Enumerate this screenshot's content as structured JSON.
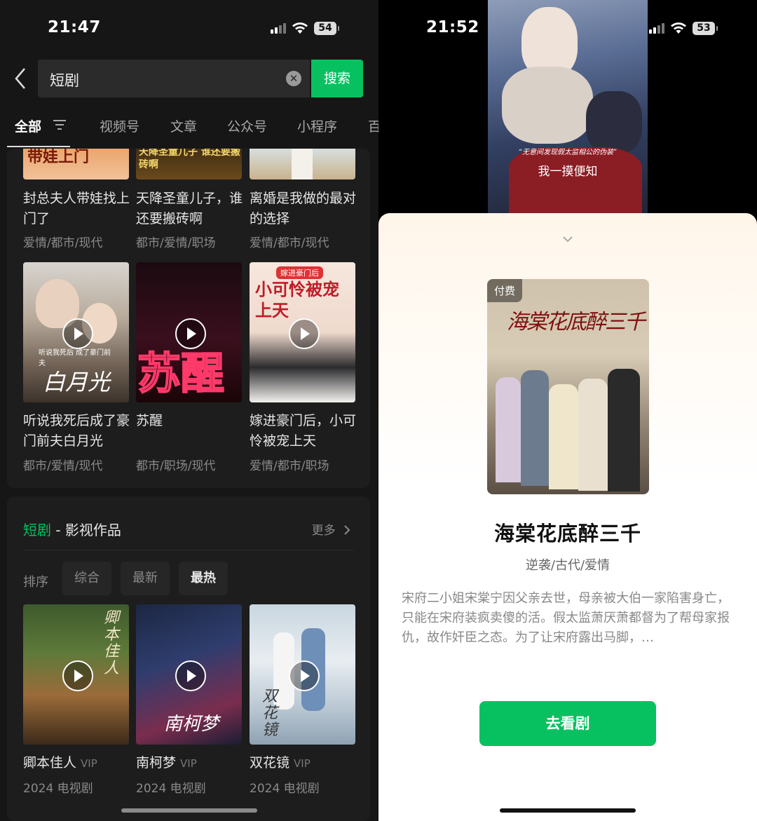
{
  "left": {
    "status": {
      "time": "21:47",
      "battery": "54"
    },
    "search": {
      "query": "短剧",
      "button": "搜索"
    },
    "tabs": [
      "全部",
      "视频号",
      "文章",
      "公众号",
      "小程序",
      "百"
    ],
    "top_items": [
      {
        "title": "封总夫人带娃找上门了",
        "meta": "爱情/都市/现代",
        "poster_text": "带娃上门"
      },
      {
        "title": "天降圣童儿子，谁还要搬砖啊",
        "meta": "都市/爱情/职场",
        "poster_text": "天降圣童儿子 谁还要搬砖啊"
      },
      {
        "title": "离婚是我做的最对的选择",
        "meta": "爱情/都市/现代"
      }
    ],
    "mid_items": [
      {
        "title": "听说我死后成了豪门前夫白月光",
        "meta": "都市/爱情/现代",
        "poster_text": "白月光",
        "poster_small": "听说我死后 成了豪门前夫"
      },
      {
        "title": "苏醒",
        "meta": "都市/职场/现代",
        "poster_text": "苏醒"
      },
      {
        "title": "嫁进豪门后，小可怜被宠上天",
        "meta": "爱情/都市/职场",
        "poster_text": "小可怜被宠上天",
        "poster_small": "嫁进豪门后"
      }
    ],
    "section": {
      "keyword": "短剧",
      "rest": " - 影视作品",
      "more": "更多",
      "sort_label": "排序",
      "chips": [
        "综合",
        "最新",
        "最热"
      ]
    },
    "works": [
      {
        "title": "卿本佳人",
        "badge": "VIP",
        "meta": "2024 电视剧",
        "poster_text": "卿本佳人"
      },
      {
        "title": "南柯梦",
        "badge": "VIP",
        "meta": "2024 电视剧",
        "poster_text": "南柯梦"
      },
      {
        "title": "双花镜",
        "badge": "VIP",
        "meta": "2024 电视剧",
        "poster_text": "双花镜"
      }
    ]
  },
  "right": {
    "status": {
      "time": "21:52",
      "battery": "53"
    },
    "video": {
      "overlay_small": "“无意间发现假太监相公的伪装”",
      "overlay_sub": "我一摸便知"
    },
    "drama": {
      "paid_tag": "付费",
      "cover_text": "海棠花底醉三千",
      "title": "海棠花底醉三千",
      "genre": "逆袭/古代/爱情",
      "description": "宋府二小姐宋棠宁因父亲去世，母亲被大伯一家陷害身亡，只能在宋府装疯卖傻的活。假太监萧厌萧都督为了帮母家报仇，故作奸臣之态。为了让宋府露出马脚，…",
      "button": "去看剧"
    }
  },
  "colors": {
    "accent": "#07c160",
    "dark_bg": "#161616",
    "card_bg": "#1d1d1d"
  }
}
